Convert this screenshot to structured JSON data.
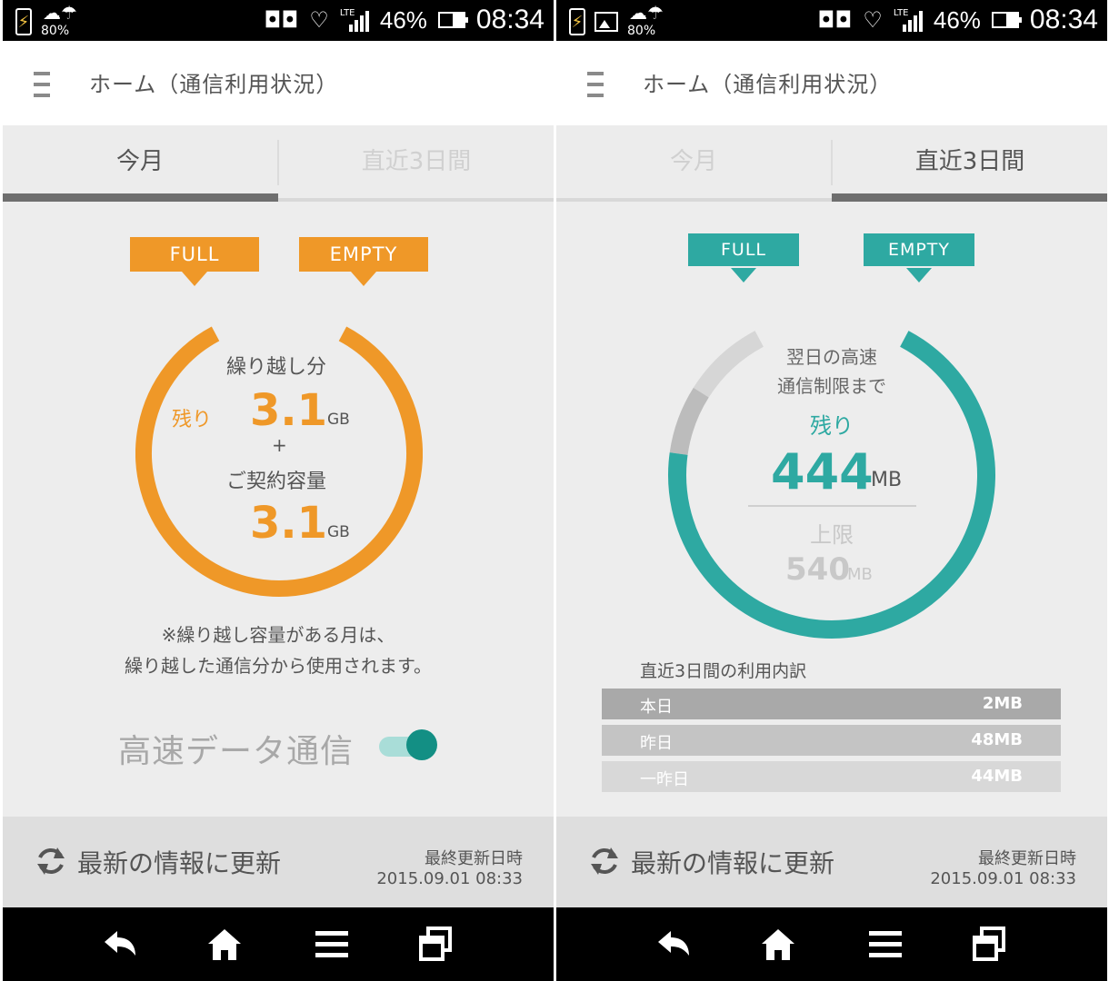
{
  "status_bar": {
    "weather_percent": "80%",
    "battery_percent": "46%",
    "time": "08:34",
    "network": "LTE"
  },
  "app": {
    "title": "ホーム（通信利用状況）"
  },
  "tabs": {
    "this_month": "今月",
    "last_3_days": "直近3日間"
  },
  "gauge_labels": {
    "full": "FULL",
    "empty": "EMPTY"
  },
  "monthly": {
    "carryover_label": "繰り越し分",
    "remaining_label": "残り",
    "carryover_value": "3.1",
    "unit": "GB",
    "plus": "+",
    "contract_label": "ご契約容量",
    "contract_value": "3.1",
    "remaining_fraction": 0.83,
    "note_line1": "※繰り越し容量がある月は、",
    "note_line2": "繰り越した通信分から使用されます。",
    "highspeed_label": "高速データ通信",
    "highspeed_on": true
  },
  "three_day": {
    "caption_line1": "翌日の高速",
    "caption_line2": "通信制限まで",
    "remaining_label": "残り",
    "remaining_value": "444",
    "remaining_unit": "MB",
    "limit_label": "上限",
    "limit_value": "540",
    "limit_unit": "MB",
    "breakdown_title": "直近3日間の利用内訳",
    "breakdown": [
      {
        "label": "本日",
        "value": "2MB"
      },
      {
        "label": "昨日",
        "value": "48MB"
      },
      {
        "label": "一昨日",
        "value": "44MB"
      }
    ]
  },
  "footer": {
    "refresh_label": "最新の情報に更新",
    "last_updated_label": "最終更新日時",
    "last_updated_value": "2015.09.01 08:33"
  },
  "colors": {
    "orange": "#ef9828",
    "teal": "#2ea9a2",
    "gray_track": "#cfcfcf"
  },
  "icons": [
    "battery-charging-icon",
    "weather-icon",
    "image-icon",
    "voicemail-icon",
    "heart-icon",
    "signal-icon",
    "battery-icon",
    "menu-icon",
    "refresh-icon",
    "back-icon",
    "home-icon",
    "menu-list-icon",
    "recent-apps-icon"
  ]
}
